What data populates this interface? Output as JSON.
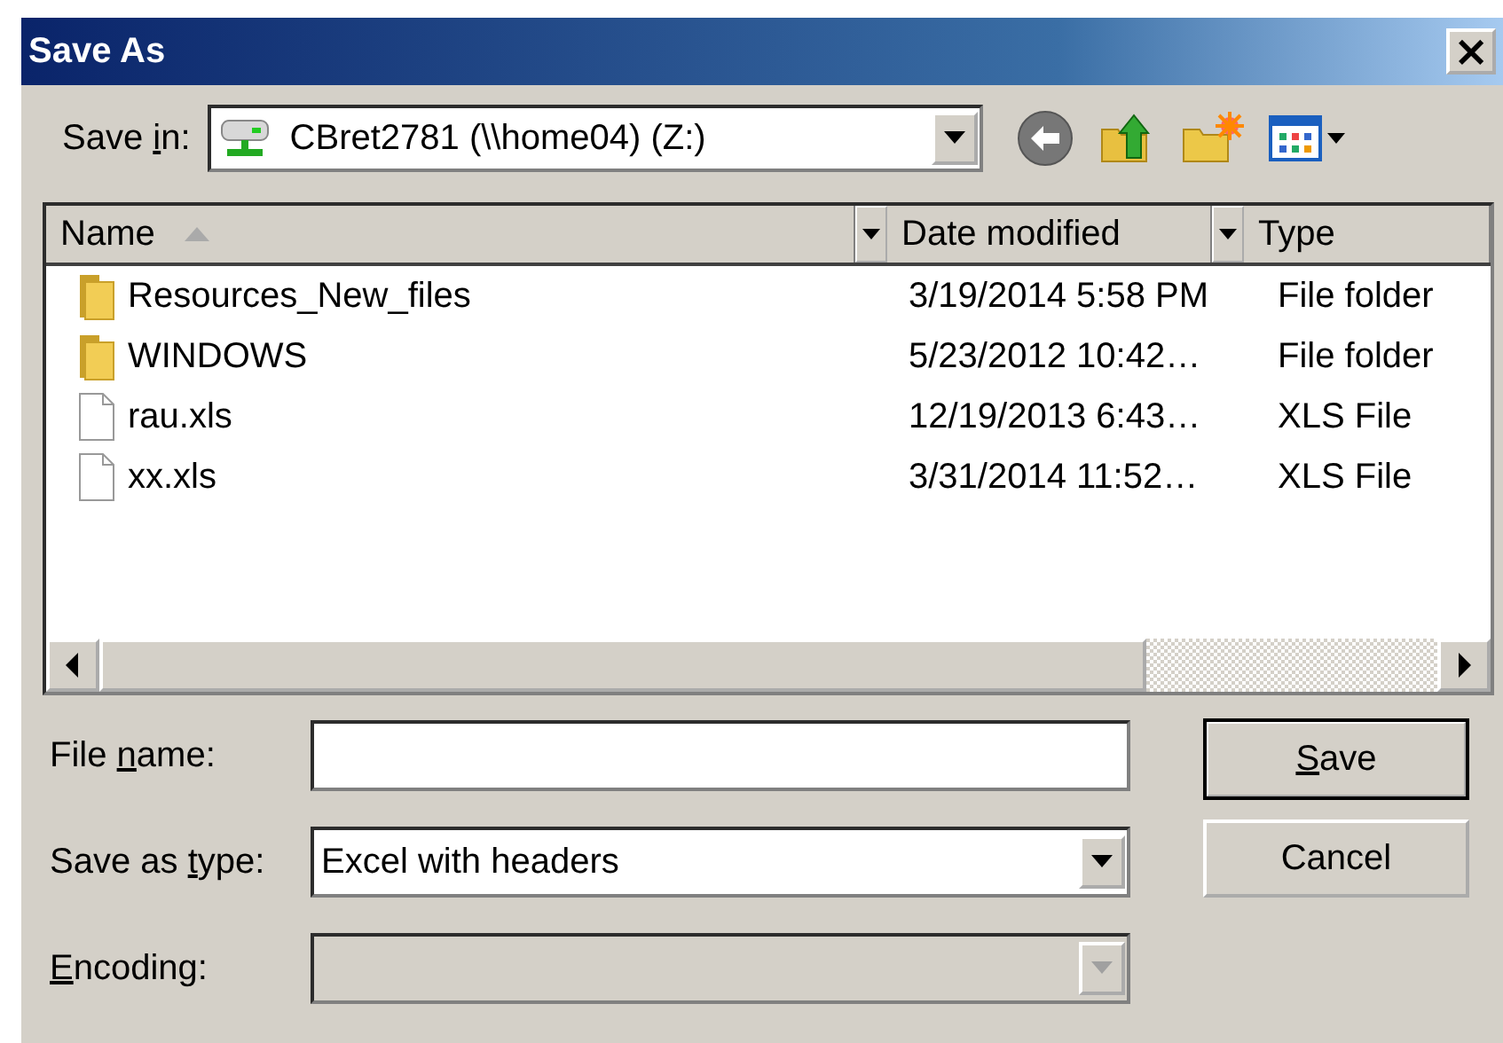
{
  "window": {
    "title": "Save As",
    "close": "×"
  },
  "save_in": {
    "label": {
      "before": "Save ",
      "key": "i",
      "after": "n:"
    },
    "value": "CBret2781 (\\\\home04) (Z:)"
  },
  "columns": [
    {
      "label": "Name",
      "sorted": true
    },
    {
      "label": "Date modified",
      "sorted": false
    },
    {
      "label": "Type",
      "sorted": false
    }
  ],
  "rows": [
    {
      "kind": "folder",
      "name": "Resources_New_files",
      "date": "3/19/2014 5:58 PM",
      "type": "File folder"
    },
    {
      "kind": "folder",
      "name": "WINDOWS",
      "date": "5/23/2012 10:42…",
      "type": "File folder"
    },
    {
      "kind": "file",
      "name": "rau.xls",
      "date": "12/19/2013 6:43…",
      "type": "XLS File"
    },
    {
      "kind": "file",
      "name": "xx.xls",
      "date": "3/31/2014 11:52…",
      "type": "XLS File"
    }
  ],
  "fields": [
    {
      "kind": "text",
      "label": {
        "before": "File ",
        "key": "n",
        "after": "ame:"
      },
      "disabled": false
    },
    {
      "kind": "combo",
      "label": {
        "before": "Save as ",
        "key": "t",
        "after": "ype:"
      },
      "value": "Excel with headers",
      "disabled": false
    },
    {
      "kind": "combo",
      "label": {
        "key": "E",
        "after": "ncoding:"
      },
      "disabled": true
    }
  ],
  "buttons": [
    {
      "label": {
        "key": "S",
        "after": "ave"
      },
      "default": true
    },
    {
      "label": {
        "before": "Cancel"
      },
      "default": false
    }
  ]
}
